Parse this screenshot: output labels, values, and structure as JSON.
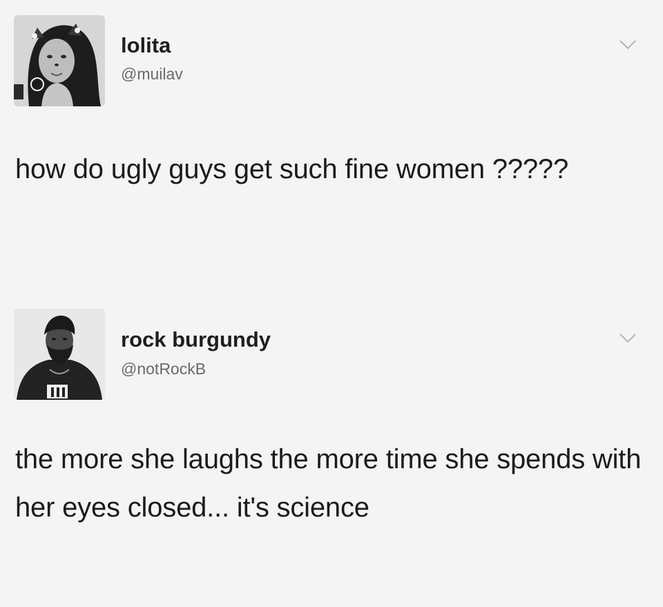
{
  "tweets": [
    {
      "display_name": "lolita",
      "handle": "@muilav",
      "text": "how do ugly guys get such fine women ?????",
      "avatar_icon": "profile-photo",
      "menu_icon": "chevron-down-icon"
    },
    {
      "display_name": "rock burgundy",
      "handle": "@notRockB",
      "text": "the more she laughs the more time she spends with her eyes closed... it's science",
      "avatar_icon": "profile-photo",
      "menu_icon": "chevron-down-icon"
    }
  ],
  "colors": {
    "background": "#f4f4f4",
    "name_text": "#1e1e1e",
    "handle_text": "#6a6a6a",
    "chevron": "#b5b5b5"
  }
}
